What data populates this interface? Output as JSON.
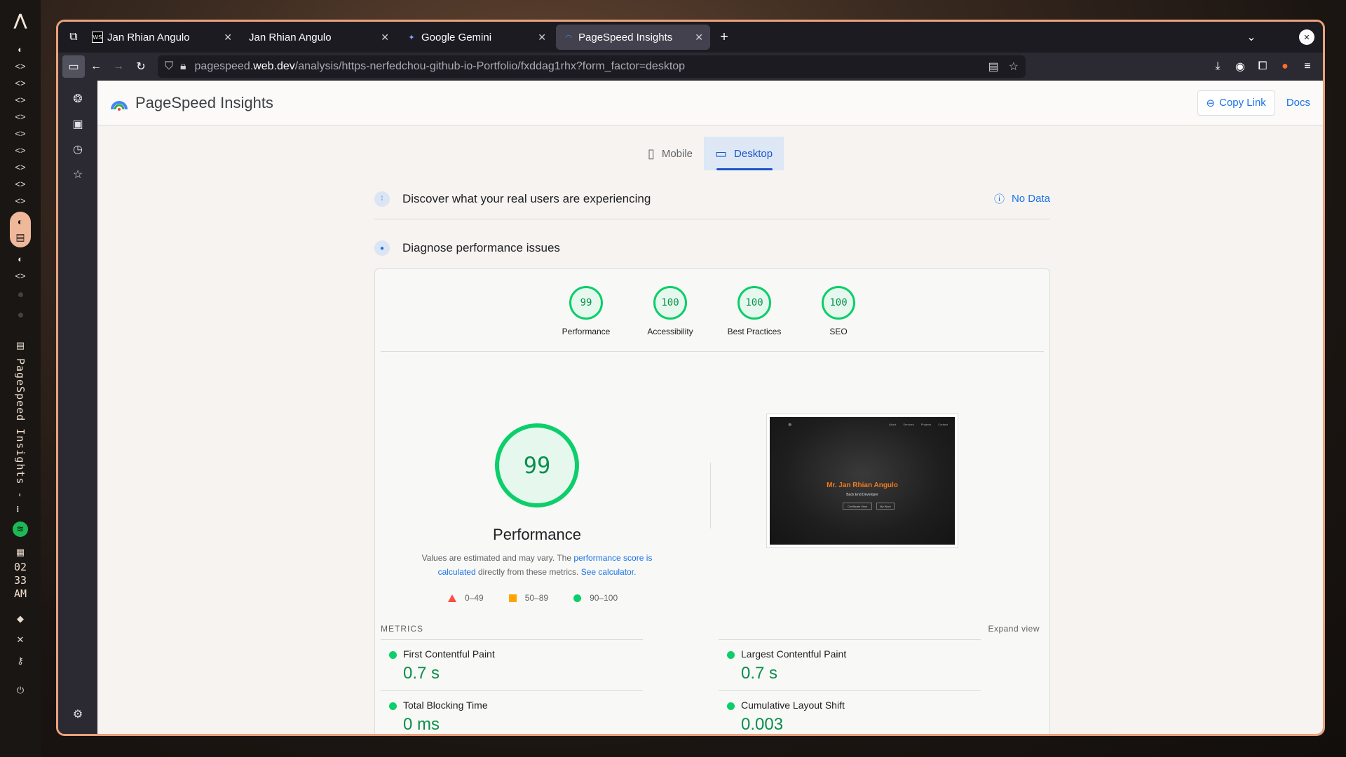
{
  "os_bar": {
    "vertical_title": "PageSpeed Insights - …",
    "clock": [
      "02",
      "33",
      "AM"
    ]
  },
  "tabs": [
    {
      "title": "Jan Rhian Angulo",
      "favicon": "ws-icon",
      "active": false
    },
    {
      "title": "Jan Rhian Angulo",
      "favicon": "",
      "active": false
    },
    {
      "title": "Google Gemini",
      "favicon": "gemini-icon",
      "active": false
    },
    {
      "title": "PageSpeed Insights",
      "favicon": "psi-icon",
      "active": true
    }
  ],
  "url": {
    "prefix": "pagespeed.",
    "host": "web.dev",
    "path": "/analysis/https-nerfedchou-github-io-Portfolio/fxddag1rhx?form_factor=desktop"
  },
  "psi": {
    "title": "PageSpeed Insights",
    "copy_link": "Copy Link",
    "docs": "Docs",
    "form_tabs": [
      {
        "label": "Mobile",
        "active": false
      },
      {
        "label": "Desktop",
        "active": true
      }
    ],
    "discover": "Discover what your real users are experiencing",
    "no_data": "No Data",
    "diagnose": "Diagnose performance issues",
    "gauges": [
      {
        "score": "99",
        "label": "Performance"
      },
      {
        "score": "100",
        "label": "Accessibility"
      },
      {
        "score": "100",
        "label": "Best Practices"
      },
      {
        "score": "100",
        "label": "SEO"
      }
    ],
    "big_score": "99",
    "big_title": "Performance",
    "disclaimer": {
      "pre": "Values are estimated and may vary. The ",
      "link1": "performance score is calculated",
      "mid": " directly from these metrics. ",
      "link2": "See calculator."
    },
    "legend": [
      "0–49",
      "50–89",
      "90–100"
    ],
    "metrics_heading": "METRICS",
    "expand_view": "Expand view",
    "metrics": [
      {
        "name": "First Contentful Paint",
        "value": "0.7 s"
      },
      {
        "name": "Largest Contentful Paint",
        "value": "0.7 s"
      },
      {
        "name": "Total Blocking Time",
        "value": "0 ms"
      },
      {
        "name": "Cumulative Layout Shift",
        "value": "0.003"
      }
    ],
    "screenshot": {
      "name": "Mr. Jan Rhian Angulo",
      "subtitle": "Back End Developer",
      "buttons": [
        "Certificate View",
        "My Work"
      ],
      "nav": [
        "About",
        "Services",
        "Projects",
        "Contact"
      ]
    }
  },
  "colors": {
    "accent": "#1a73e8",
    "pass": "#0cce6b",
    "window_border": "#e9a27c"
  }
}
